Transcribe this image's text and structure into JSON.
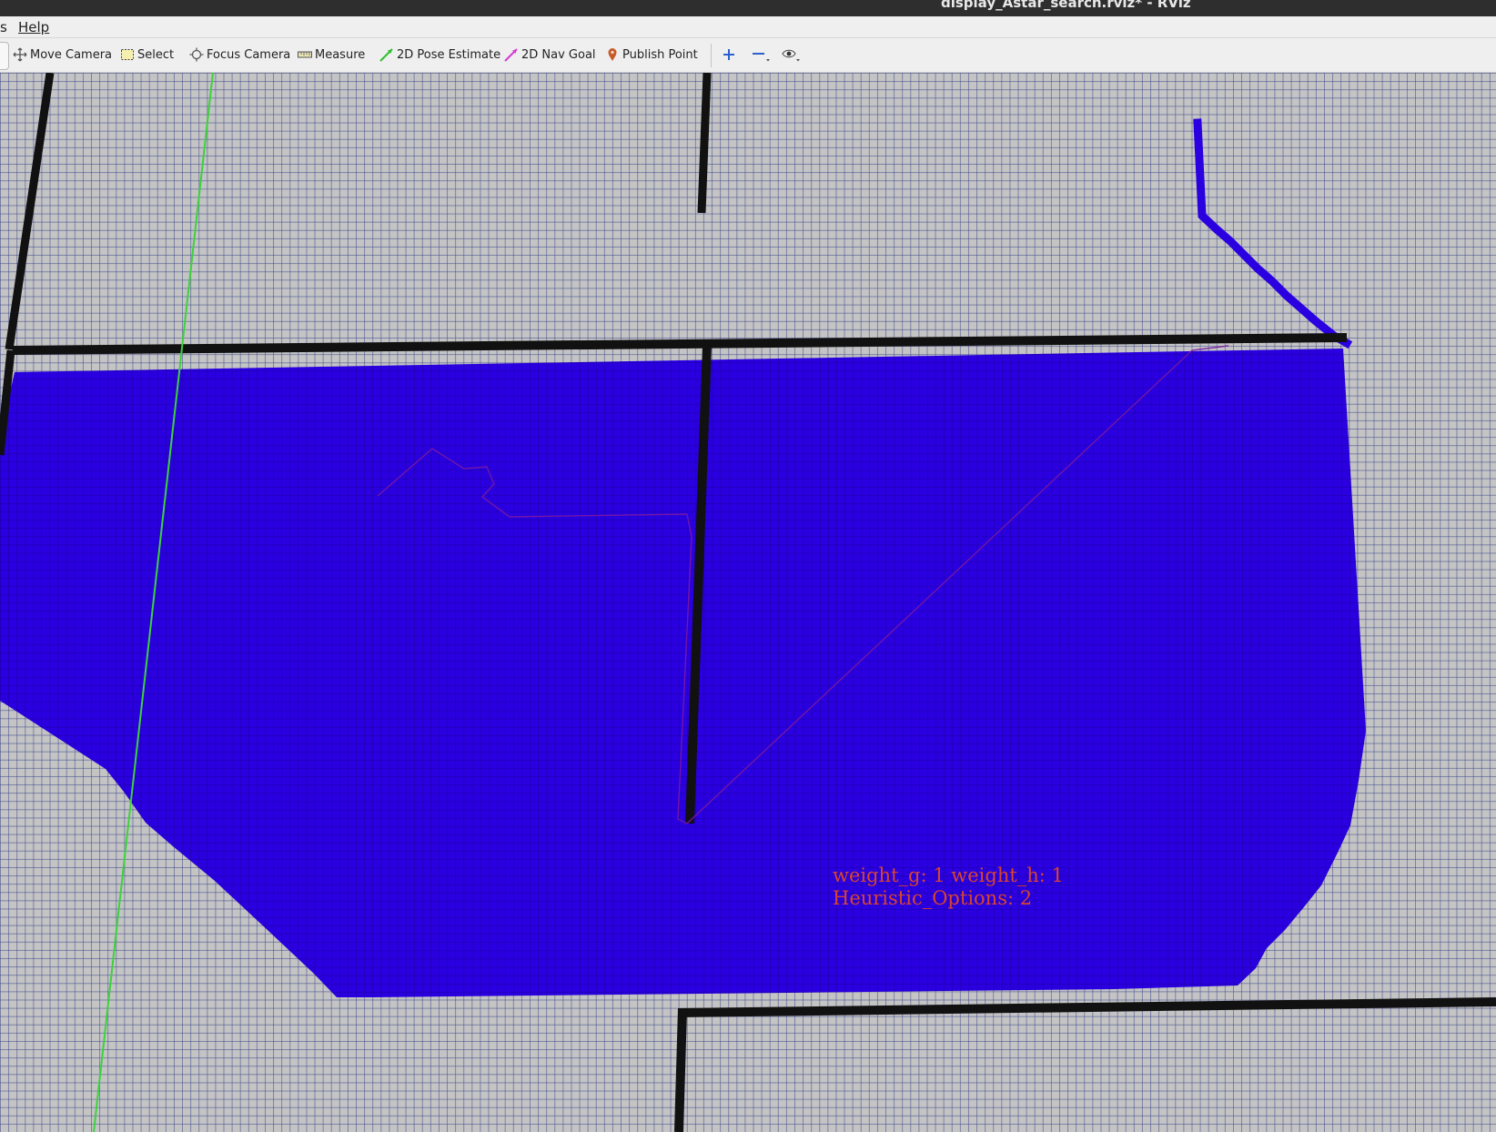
{
  "window": {
    "title": "display_Astar_search.rviz* - RViz"
  },
  "menubar": {
    "items": [
      {
        "label": "s"
      },
      {
        "label": "Help"
      }
    ]
  },
  "toolbar": {
    "tools": [
      {
        "label": "Move Camera",
        "icon": "move-camera-icon"
      },
      {
        "label": "Select",
        "icon": "select-icon"
      },
      {
        "label": "Focus Camera",
        "icon": "focus-camera-icon"
      },
      {
        "label": "Measure",
        "icon": "measure-icon"
      },
      {
        "label": "2D Pose Estimate",
        "icon": "pose-estimate-arrow-icon"
      },
      {
        "label": "2D Nav Goal",
        "icon": "nav-goal-arrow-icon"
      },
      {
        "label": "Publish Point",
        "icon": "map-pin-icon"
      }
    ],
    "view_buttons": [
      {
        "icon": "plus-icon"
      },
      {
        "icon": "minus-icon"
      },
      {
        "icon": "eye-icon"
      }
    ]
  },
  "viewport": {
    "overlay_text": {
      "line1": "weight_g: 1 weight_h: 1",
      "line2": "Heuristic_Options: 2"
    },
    "colors": {
      "grid_background": "#c4c4c4",
      "grid_lines": "#3c468c",
      "obstacle": "#111111",
      "explored_region": "#2a00e0",
      "path": "#7a1aa0",
      "axis_line": "#3cd23c",
      "overlay_text": "#d8452e"
    }
  }
}
